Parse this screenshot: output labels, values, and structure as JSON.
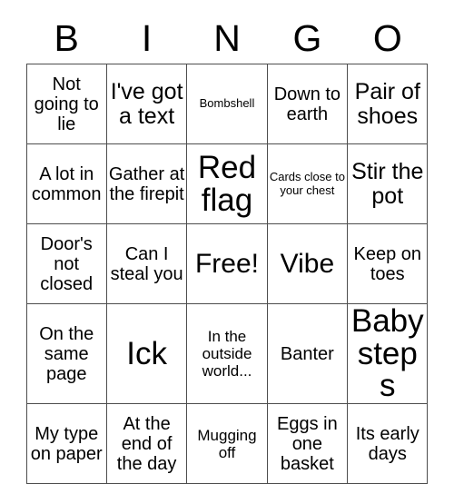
{
  "header": {
    "letters": [
      "B",
      "I",
      "N",
      "G",
      "O"
    ]
  },
  "grid": {
    "rows": 5,
    "columns": 5,
    "cells": [
      [
        {
          "text": "Not going to lie",
          "size": "md"
        },
        {
          "text": "I've got a text",
          "size": "lg"
        },
        {
          "text": "Bombshell",
          "size": "xs"
        },
        {
          "text": "Down to earth",
          "size": "md"
        },
        {
          "text": "Pair of shoes",
          "size": "lg"
        }
      ],
      [
        {
          "text": "A lot in common",
          "size": "md"
        },
        {
          "text": "Gather at the firepit",
          "size": "md"
        },
        {
          "text": "Red flag",
          "size": "xxl"
        },
        {
          "text": "Cards close to your chest",
          "size": "xs"
        },
        {
          "text": "Stir the pot",
          "size": "lg"
        }
      ],
      [
        {
          "text": "Door's not closed",
          "size": "md"
        },
        {
          "text": "Can I steal you",
          "size": "md"
        },
        {
          "text": "Free!",
          "size": "xl"
        },
        {
          "text": "Vibe",
          "size": "xl"
        },
        {
          "text": "Keep on toes",
          "size": "md"
        }
      ],
      [
        {
          "text": "On the same page",
          "size": "md"
        },
        {
          "text": "Ick",
          "size": "xxl"
        },
        {
          "text": "In the outside world...",
          "size": "sm"
        },
        {
          "text": "Banter",
          "size": "md"
        },
        {
          "text": "Baby steps",
          "size": "xxl"
        }
      ],
      [
        {
          "text": "My type on paper",
          "size": "md"
        },
        {
          "text": "At the end of the day",
          "size": "md"
        },
        {
          "text": "Mugging off",
          "size": "sm"
        },
        {
          "text": "Eggs in one basket",
          "size": "md"
        },
        {
          "text": "Its early days",
          "size": "md"
        }
      ]
    ]
  },
  "colors": {
    "background": "#ffffff",
    "text": "#000000",
    "border": "#4d4d4d"
  }
}
